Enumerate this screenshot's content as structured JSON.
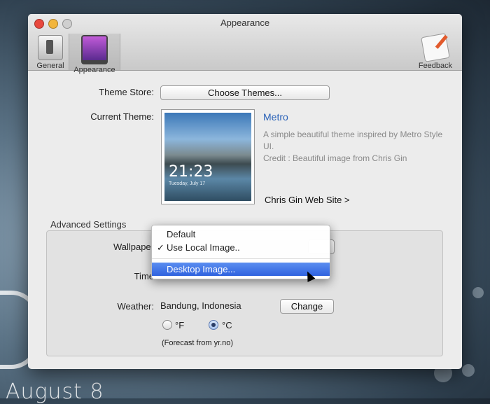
{
  "window": {
    "title": "Appearance"
  },
  "toolbar": {
    "general": "General",
    "appearance": "Appearance",
    "feedback": "Feedback"
  },
  "theme_store": {
    "label": "Theme Store:",
    "button": "Choose Themes..."
  },
  "current_theme": {
    "label": "Current Theme:",
    "name": "Metro",
    "description": "A simple beautiful theme inspired by Metro Style UI.",
    "credit": "Credit : Beautiful image from Chris Gin",
    "link": "Chris Gin Web Site >",
    "thumb_time": "21:23",
    "thumb_date": "Tuesday, July 17"
  },
  "advanced": {
    "title": "Advanced Settings",
    "wallpaper_label": "Wallpaper",
    "time_label": "Time",
    "weather_label": "Weather:",
    "location": "Bandung, Indonesia",
    "change_button": "Change",
    "unit_f": "°F",
    "unit_c": "°C",
    "selected_unit": "C",
    "forecast_note": "(Forecast from yr.no)"
  },
  "wallpaper_menu": {
    "items": [
      "Default",
      "Use Local Image..",
      "Desktop Image..."
    ],
    "checked": "Use Local Image..",
    "highlighted": "Desktop Image..."
  },
  "desktop": {
    "date": "August 8"
  },
  "colors": {
    "accent": "#2a62b8",
    "menu_highlight": "#3b6fe3"
  }
}
